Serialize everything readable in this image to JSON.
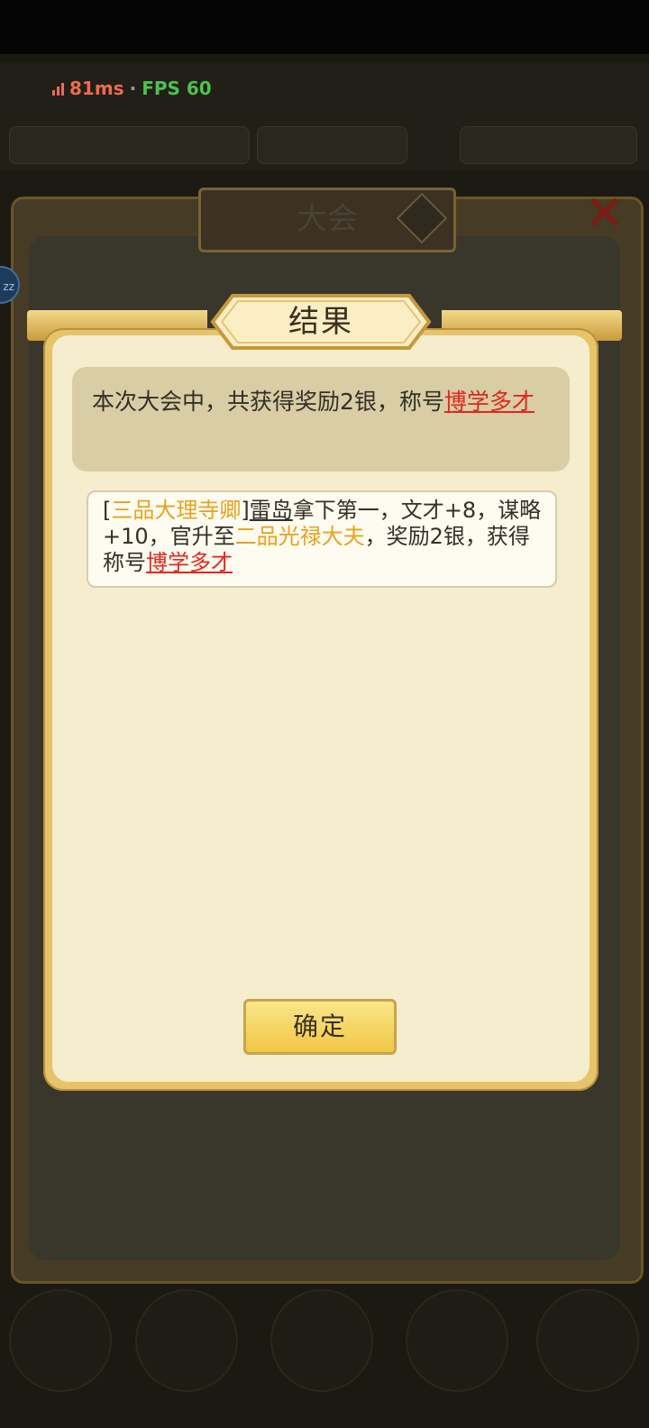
{
  "status": {
    "latency": "81ms",
    "separator": "·",
    "fps": "FPS 60"
  },
  "background_panel": {
    "title": "大会"
  },
  "result_dialog": {
    "title": "结果",
    "summary": {
      "prefix": "本次大会中，共获得奖励2银，称号",
      "honor_title": "博学多才"
    },
    "detail": {
      "open_bracket": "[",
      "rank_before": "三品大理寺卿",
      "close_bracket": "]",
      "player_name": "雷岛",
      "text1": "拿下第一，文才+8，谋略+10，官升至",
      "rank_after": "二品光禄大夫",
      "text2": "，奖励2银，获得称号",
      "honor_title": "博学多才"
    },
    "confirm_label": "确定"
  },
  "colors": {
    "accent_gold": "#e8a21f",
    "link_red": "#e0281e",
    "dialog_bg": "#f6edce"
  }
}
